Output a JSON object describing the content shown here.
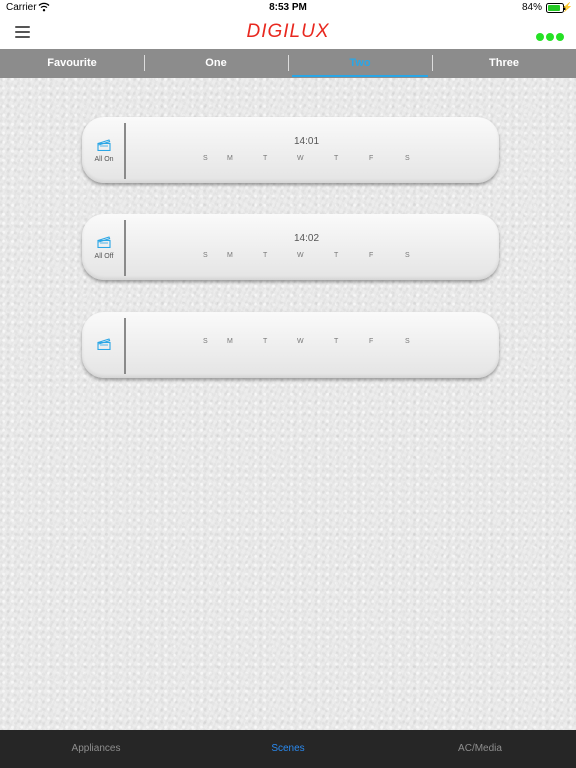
{
  "status_bar": {
    "carrier": "Carrier",
    "time": "8:53 PM",
    "battery": "84%"
  },
  "nav": {
    "logo": "DIGILUX",
    "logo_color": "#e8281f",
    "more_dots_color": "#25e125"
  },
  "tabs": [
    {
      "label": "Favourite",
      "active": false
    },
    {
      "label": "One",
      "active": false
    },
    {
      "label": "Two",
      "active": true
    },
    {
      "label": "Three",
      "active": false
    }
  ],
  "accent_color": "#2aa6e6",
  "days": [
    "S",
    "M",
    "T",
    "W",
    "T",
    "F",
    "S"
  ],
  "scenes": [
    {
      "label": "All On",
      "time": "14:01",
      "icon": "clapperboard-icon"
    },
    {
      "label": "All Off",
      "time": "14:02",
      "icon": "clapperboard-icon"
    },
    {
      "label": "",
      "time": "",
      "icon": "clapperboard-icon"
    }
  ],
  "bottom_tabs": [
    {
      "label": "Appliances",
      "active": false
    },
    {
      "label": "Scenes",
      "active": true
    },
    {
      "label": "AC/Media",
      "active": false
    }
  ]
}
